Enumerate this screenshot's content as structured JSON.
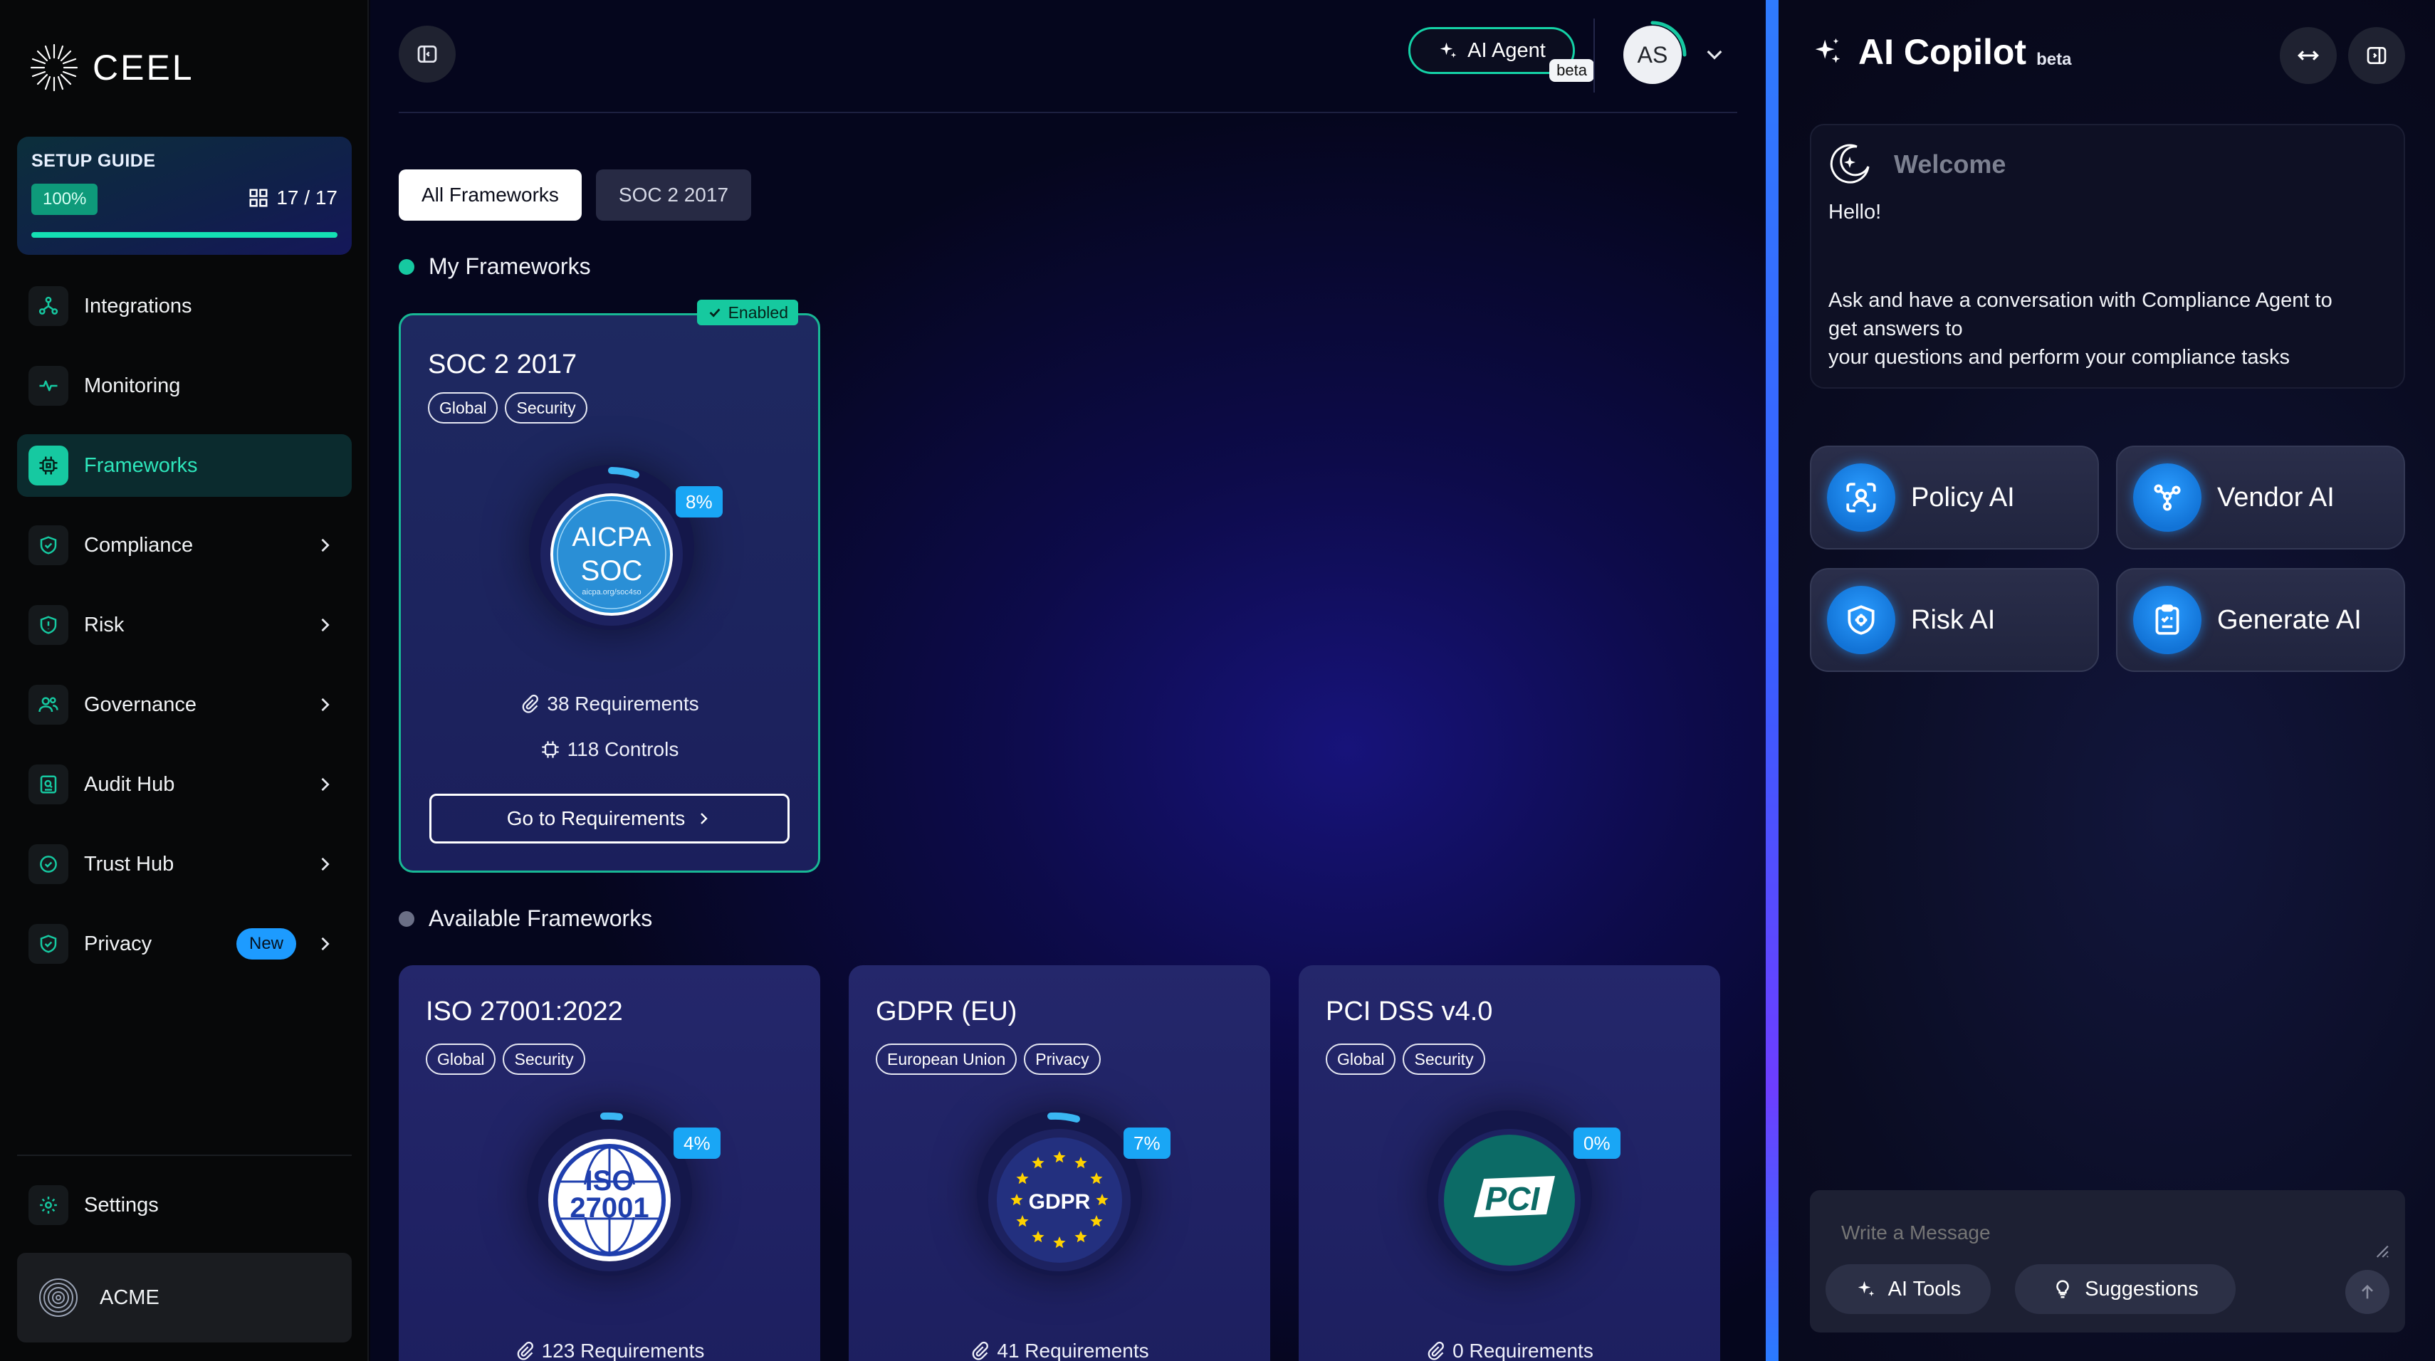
{
  "brand": {
    "name": "CEEL"
  },
  "setup_guide": {
    "title": "SETUP GUIDE",
    "percent_label": "100%",
    "progress": 1.0,
    "count": "17 / 17"
  },
  "nav": {
    "integrations": "Integrations",
    "monitoring": "Monitoring",
    "frameworks": "Frameworks",
    "compliance": "Compliance",
    "risk": "Risk",
    "governance": "Governance",
    "audit_hub": "Audit Hub",
    "trust_hub": "Trust Hub",
    "privacy": "Privacy",
    "privacy_badge": "New",
    "settings": "Settings"
  },
  "org": {
    "name": "ACME"
  },
  "header": {
    "ai_agent_label": "AI Agent",
    "ai_agent_badge": "beta",
    "avatar_initials": "AS"
  },
  "tabs": {
    "all": "All Frameworks",
    "soc2": "SOC 2 2017"
  },
  "sections": {
    "mine": "My Frameworks",
    "available": "Available Frameworks"
  },
  "my_frameworks": [
    {
      "title": "SOC 2 2017",
      "tags": [
        "Global",
        "Security"
      ],
      "status": "Enabled",
      "progress_label": "8%",
      "requirements": "38 Requirements",
      "controls": "118 Controls",
      "cta": "Go to Requirements",
      "emblem": {
        "line1": "AICPA",
        "line2": "SOC",
        "small": "aicpa.org/soc4so"
      }
    }
  ],
  "available_frameworks": [
    {
      "title": "ISO 27001:2022",
      "tags": [
        "Global",
        "Security"
      ],
      "progress_label": "4%",
      "requirements": "123 Requirements",
      "emblem": {
        "line1": "ISO",
        "line2": "27001"
      }
    },
    {
      "title": "GDPR (EU)",
      "tags": [
        "European Union",
        "Privacy"
      ],
      "progress_label": "7%",
      "requirements": "41 Requirements",
      "emblem": {
        "line1": "GDPR"
      }
    },
    {
      "title": "PCI DSS v4.0",
      "tags": [
        "Global",
        "Security"
      ],
      "progress_label": "0%",
      "requirements": "0 Requirements",
      "emblem": {
        "line1": "PCI"
      }
    }
  ],
  "copilot": {
    "title": "AI Copilot",
    "badge": "beta",
    "welcome_title": "Welcome",
    "hello": "Hello!",
    "body_line1": "Ask and have a conversation with Compliance Agent to",
    "body_line2": "get answers to",
    "body_line3": "your questions and perform your compliance tasks",
    "tiles": [
      "Policy AI",
      "Vendor AI",
      "Risk AI",
      "Generate AI"
    ],
    "placeholder": "Write a Message",
    "ai_tools": "AI Tools",
    "suggestions": "Suggestions"
  },
  "colors": {
    "accent_teal": "#16c9a1",
    "badge_blue": "#19a6f5",
    "panel_blue": "#2f7bff"
  }
}
